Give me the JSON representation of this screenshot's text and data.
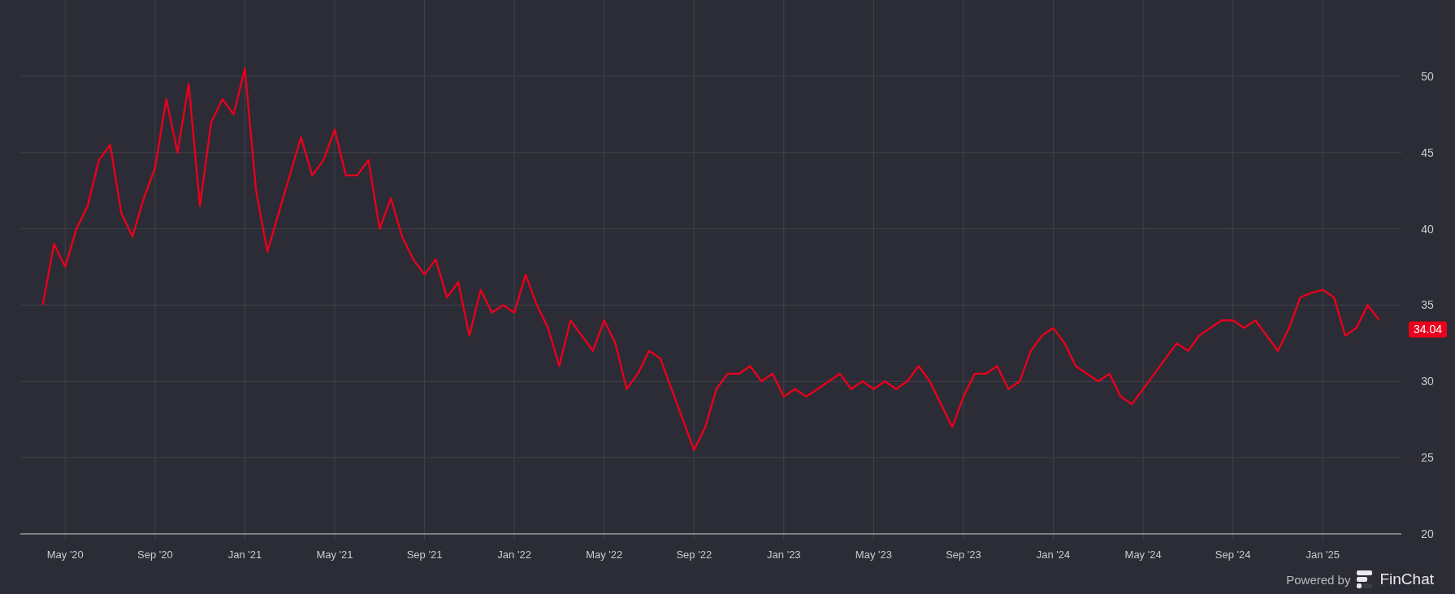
{
  "chart": {
    "price_label": "34.04",
    "chart_data": {
      "type": "line",
      "grid": true,
      "ylim": [
        20,
        55
      ],
      "categories": [
        null,
        null,
        "May '20",
        null,
        null,
        null,
        null,
        null,
        null,
        null,
        "Sep '20",
        null,
        null,
        null,
        null,
        null,
        null,
        null,
        "Jan '21",
        null,
        null,
        null,
        null,
        null,
        null,
        null,
        "May '21",
        null,
        null,
        null,
        null,
        null,
        null,
        null,
        "Sep '21",
        null,
        null,
        null,
        null,
        null,
        null,
        null,
        "Jan '22",
        null,
        null,
        null,
        null,
        null,
        null,
        null,
        "May '22",
        null,
        null,
        null,
        null,
        null,
        null,
        null,
        "Sep '22",
        null,
        null,
        null,
        null,
        null,
        null,
        null,
        "Jan '23",
        null,
        null,
        null,
        null,
        null,
        null,
        null,
        "May '23",
        null,
        null,
        null,
        null,
        null,
        null,
        null,
        "Sep '23",
        null,
        null,
        null,
        null,
        null,
        null,
        null,
        "Jan '24",
        null,
        null,
        null,
        null,
        null,
        null,
        null,
        "May '24",
        null,
        null,
        null,
        null,
        null,
        null,
        null,
        "Sep '24",
        null,
        null,
        null,
        null,
        null,
        null,
        null,
        "Jan '25",
        null,
        null,
        null,
        null,
        null
      ],
      "yticks": [
        20,
        25,
        30,
        35,
        40,
        45,
        50
      ],
      "series": [
        {
          "color": "#e8001c",
          "values": [
            35,
            39,
            37.5,
            40,
            41.5,
            44.5,
            45.5,
            41,
            39.5,
            42,
            44,
            48.5,
            45,
            49.5,
            41.5,
            47,
            48.5,
            47.5,
            50.5,
            42.5,
            38.5,
            41,
            43.5,
            46,
            43.5,
            44.5,
            46.5,
            43.5,
            43.5,
            44.5,
            40,
            42,
            39.5,
            38,
            37,
            38,
            35.5,
            36.5,
            33,
            36,
            34.5,
            35,
            34.5,
            37,
            35,
            33.5,
            31,
            34,
            33,
            32,
            34,
            32.5,
            29.5,
            30.5,
            32,
            31.5,
            29.5,
            27.5,
            25.5,
            27,
            29.5,
            30.5,
            30.5,
            31,
            30,
            30.5,
            29,
            29.5,
            29,
            29.5,
            30,
            30.5,
            29.5,
            30,
            29.5,
            30,
            29.5,
            30,
            31,
            30,
            28.5,
            27,
            29,
            30.5,
            30.5,
            31,
            29.5,
            30,
            32,
            33,
            33.5,
            32.5,
            31,
            30.5,
            30,
            30.5,
            29,
            28.5,
            29.5,
            30.5,
            31.5,
            32.5,
            32,
            33,
            33.5,
            34,
            34,
            33.5,
            34,
            33,
            32,
            33.5,
            35.5,
            35.8,
            36,
            35.5,
            33,
            33.5,
            35,
            34.04
          ]
        }
      ]
    }
  },
  "attribution": {
    "prefix": "Powered by",
    "brand": "FinChat"
  }
}
